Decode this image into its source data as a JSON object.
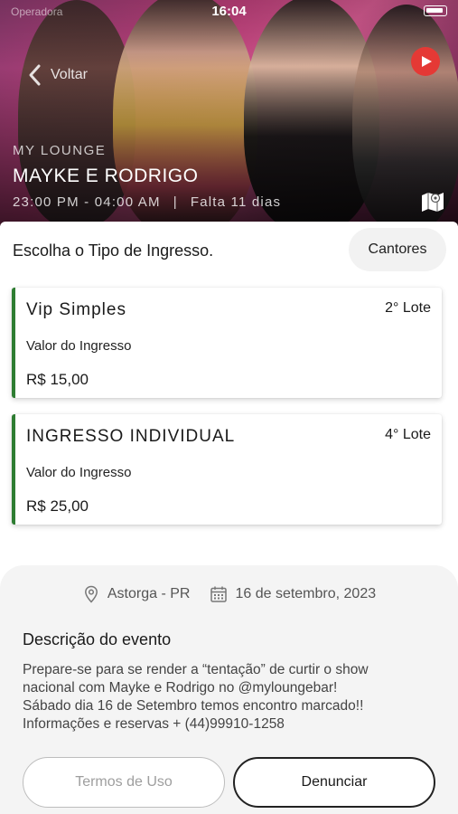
{
  "status_bar": {
    "time": "16:04",
    "left_text": "Operadora"
  },
  "header": {
    "back_label": "Voltar",
    "venue": "MY LOUNGE",
    "title": "MAYKE E RODRIGO",
    "time_range": "23:00 PM - 04:00 AM",
    "separator": "|",
    "countdown": "Falta 11 dias"
  },
  "tickets_section": {
    "heading": "Escolha o Tipo de Ingresso.",
    "singers_button": "Cantores",
    "accent_color": "#2e7d32",
    "tickets": [
      {
        "name": "Vip Simples",
        "lote": "2° Lote",
        "value_label": "Valor do Ingresso",
        "price": "R$ 15,00"
      },
      {
        "name": "INGRESSO INDIVIDUAL",
        "lote": "4° Lote",
        "value_label": "Valor do Ingresso",
        "price": "R$ 25,00"
      }
    ]
  },
  "details": {
    "location": "Astorga - PR",
    "date": "16 de setembro, 2023",
    "description_title": "Descrição do evento",
    "description_lines": [
      "Prepare-se para se render a “tentação” de curtir o show",
      "nacional com Mayke e Rodrigo no @myloungebar!",
      "Sábado dia 16 de Setembro temos encontro marcado!!",
      "Informações e reservas  + (44)99910-1258"
    ],
    "terms_button": "Termos de Uso",
    "report_button": "Denunciar"
  },
  "icons": {
    "back": "chevron-left-icon",
    "play": "play-icon",
    "map": "map-icon",
    "location": "location-pin-icon",
    "calendar": "calendar-icon"
  }
}
